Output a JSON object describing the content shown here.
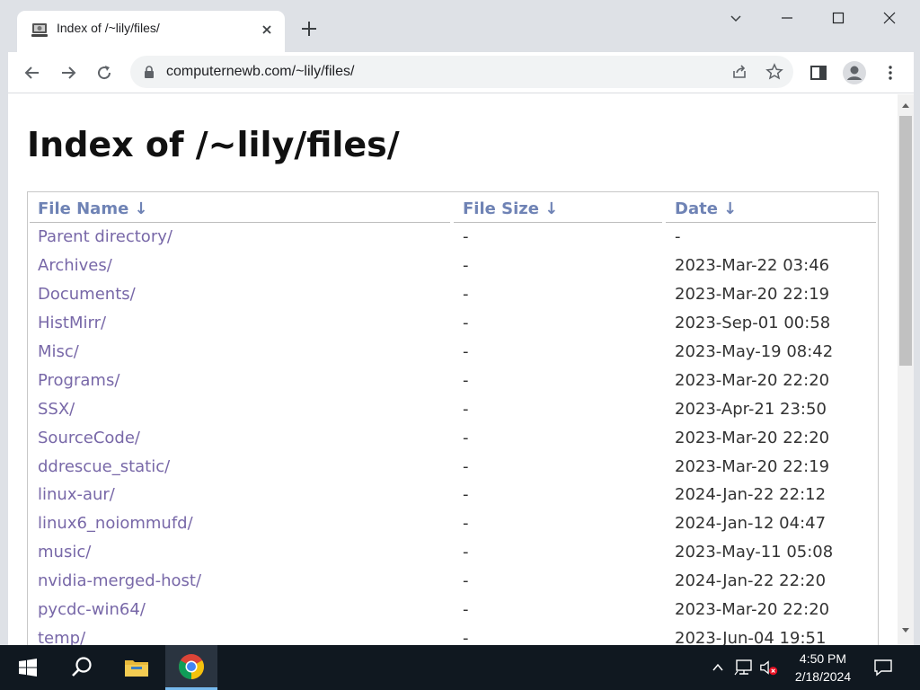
{
  "browser": {
    "tab_title": "Index of /~lily/files/",
    "url": "computernewb.com/~lily/files/"
  },
  "page": {
    "title": "Index of /~lily/files/",
    "columns": {
      "name": "File Name  ↓",
      "size": "File Size  ↓",
      "date": "Date  ↓"
    },
    "rows": [
      {
        "name": "Parent directory/",
        "size": "-",
        "date": "-"
      },
      {
        "name": "Archives/",
        "size": "-",
        "date": "2023-Mar-22 03:46"
      },
      {
        "name": "Documents/",
        "size": "-",
        "date": "2023-Mar-20 22:19"
      },
      {
        "name": "HistMirr/",
        "size": "-",
        "date": "2023-Sep-01 00:58"
      },
      {
        "name": "Misc/",
        "size": "-",
        "date": "2023-May-19 08:42"
      },
      {
        "name": "Programs/",
        "size": "-",
        "date": "2023-Mar-20 22:20"
      },
      {
        "name": "SSX/",
        "size": "-",
        "date": "2023-Apr-21 23:50"
      },
      {
        "name": "SourceCode/",
        "size": "-",
        "date": "2023-Mar-20 22:20"
      },
      {
        "name": "ddrescue_static/",
        "size": "-",
        "date": "2023-Mar-20 22:19"
      },
      {
        "name": "linux-aur/",
        "size": "-",
        "date": "2024-Jan-22 22:12"
      },
      {
        "name": "linux6_noiommufd/",
        "size": "-",
        "date": "2024-Jan-12 04:47"
      },
      {
        "name": "music/",
        "size": "-",
        "date": "2023-May-11 05:08"
      },
      {
        "name": "nvidia-merged-host/",
        "size": "-",
        "date": "2024-Jan-22 22:20"
      },
      {
        "name": "pycdc-win64/",
        "size": "-",
        "date": "2023-Mar-20 22:20"
      },
      {
        "name": "temp/",
        "size": "-",
        "date": "2023-Jun-04 19:51"
      }
    ]
  },
  "taskbar": {
    "time": "4:50 PM",
    "date": "2/18/2024"
  },
  "colors": {
    "link": "#7868a8",
    "header_link": "#6f83b5",
    "taskbar": "#101820",
    "chrome_frame": "#dee1e6"
  }
}
